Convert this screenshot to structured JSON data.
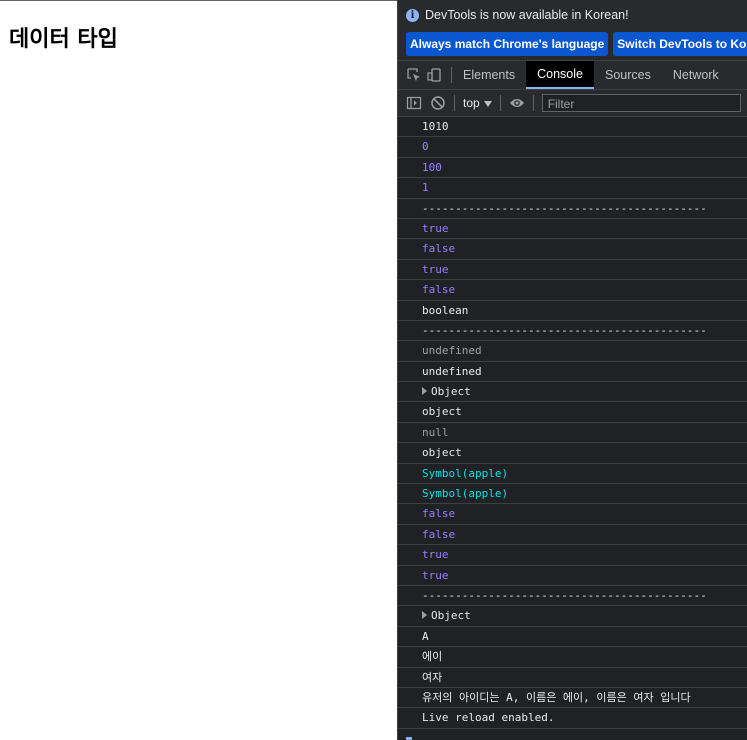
{
  "page": {
    "heading": "데이터 타입"
  },
  "devtools": {
    "infobar": {
      "message": "DevTools is now available in Korean!",
      "buttons": [
        "Always match Chrome's language",
        "Switch DevTools to Korean"
      ]
    },
    "tabs": [
      "Elements",
      "Console",
      "Sources",
      "Network"
    ],
    "active_tab": "Console",
    "toolbar": {
      "context": "top",
      "filter_placeholder": "Filter"
    },
    "console": [
      {
        "text": "1010",
        "kind": "default"
      },
      {
        "text": "0",
        "kind": "number"
      },
      {
        "text": "100",
        "kind": "number"
      },
      {
        "text": "1",
        "kind": "number"
      },
      {
        "text": "-------------------------------------------",
        "kind": "default"
      },
      {
        "text": "true",
        "kind": "bool"
      },
      {
        "text": "false",
        "kind": "bool"
      },
      {
        "text": "true",
        "kind": "bool"
      },
      {
        "text": "false",
        "kind": "bool"
      },
      {
        "text": "boolean",
        "kind": "default"
      },
      {
        "text": "-------------------------------------------",
        "kind": "default"
      },
      {
        "text": "undefined",
        "kind": "undef"
      },
      {
        "text": "undefined",
        "kind": "default"
      },
      {
        "text": "Object",
        "kind": "object"
      },
      {
        "text": "object",
        "kind": "default"
      },
      {
        "text": "null",
        "kind": "undef"
      },
      {
        "text": "object",
        "kind": "default"
      },
      {
        "text": "Symbol(apple)",
        "kind": "symbol"
      },
      {
        "text": "Symbol(apple)",
        "kind": "symbol"
      },
      {
        "text": "false",
        "kind": "bool"
      },
      {
        "text": "false",
        "kind": "bool"
      },
      {
        "text": "true",
        "kind": "bool"
      },
      {
        "text": "true",
        "kind": "bool"
      },
      {
        "text": "-------------------------------------------",
        "kind": "default"
      },
      {
        "text": "Object",
        "kind": "object"
      },
      {
        "text": "A",
        "kind": "default"
      },
      {
        "text": "에이",
        "kind": "default"
      },
      {
        "text": "여자",
        "kind": "default"
      },
      {
        "text": "유저의 아이디는 A, 이름은 에이, 이름은 여자 입니다",
        "kind": "default"
      },
      {
        "text": "Live reload enabled.",
        "kind": "default"
      }
    ]
  },
  "colors": {
    "panel_bg": "#202124",
    "number": "#9980ff",
    "symbol": "#00e5e5",
    "info_button": "#0b57d0"
  },
  "icons": [
    "info-icon",
    "inspect-icon",
    "device-toolbar-icon",
    "sidebar-toggle-icon",
    "clear-console-icon",
    "dropdown-arrow-icon",
    "eye-icon",
    "expand-triangle-icon"
  ]
}
